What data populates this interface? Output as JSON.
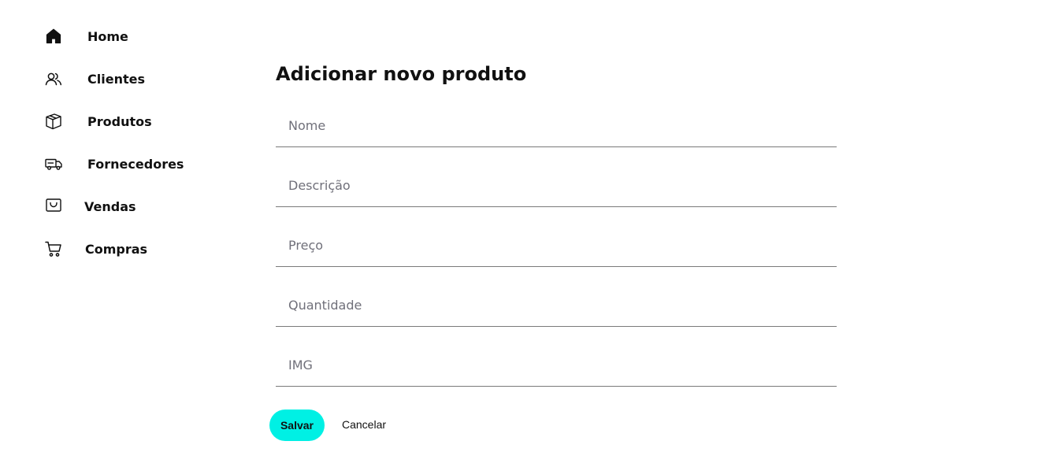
{
  "sidebar": {
    "items": [
      {
        "label": "Home",
        "icon": "home-icon"
      },
      {
        "label": "Clientes",
        "icon": "users-icon"
      },
      {
        "label": "Produtos",
        "icon": "box-icon"
      },
      {
        "label": "Fornecedores",
        "icon": "truck-icon"
      },
      {
        "label": "Vendas",
        "icon": "bag-icon"
      },
      {
        "label": "Compras",
        "icon": "cart-icon"
      }
    ]
  },
  "form": {
    "title": "Adicionar novo produto",
    "fields": [
      {
        "placeholder": "Nome",
        "value": ""
      },
      {
        "placeholder": "Descrição",
        "value": ""
      },
      {
        "placeholder": "Preço",
        "value": ""
      },
      {
        "placeholder": "Quantidade",
        "value": ""
      },
      {
        "placeholder": "IMG",
        "value": ""
      }
    ],
    "save_label": "Salvar",
    "cancel_label": "Cancelar"
  },
  "colors": {
    "accent": "#00f0e4",
    "text": "#111111",
    "placeholder": "#70707a",
    "underline": "#7a7a7a"
  }
}
